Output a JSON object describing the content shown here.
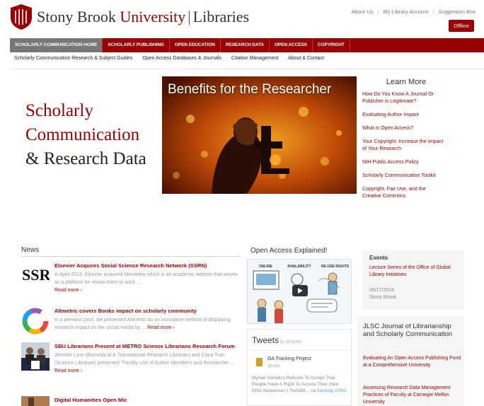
{
  "header": {
    "brand_part1": "Stony Brook ",
    "brand_part2": "University",
    "brand_sep": "|",
    "brand_part3": "Libraries",
    "top_links": [
      "About Us",
      "My Library Account",
      "Suggestion Box"
    ],
    "offline_label": "Offline",
    "accent_color": "#990000"
  },
  "main_nav": [
    "SCHOLARLY COMMUNICATION HOME",
    "SCHOLARLY PUBLISHING",
    "OPEN EDUCATION",
    "RESEARCH DATA",
    "OPEN ACCESS",
    "COPYRIGHT"
  ],
  "sub_nav": [
    "Scholarly Communication Research & Subject Guides",
    "Open Access Databases & Journals",
    "Citation Management",
    "About & Contact"
  ],
  "hero": {
    "title_line1": "Scholarly",
    "title_line2": "Communication",
    "title_line3": "& Research Data",
    "image_caption": "Benefits for the Researcher"
  },
  "learn_more": {
    "title": "Learn More",
    "items": [
      "How Do You Know A Journal Or Publisher is Legitimate?",
      "Evaluating Author Impact",
      "What is Open Access?",
      "Your Copyright: Increase the Impact of Your Research",
      "NIH Public Access Policy",
      "Scholarly Communication Toolkit",
      "Copyright, Fair Use, and the Creative Commons"
    ]
  },
  "news": {
    "title": "News",
    "items": [
      {
        "headline": "Elsevier Acquires Social Science Research Network (SSRN)",
        "text": "In April 2013, Elsevier acquired Mendeley which is an academic website that serves as a platform for researchers to work ...",
        "more": "Read more ›",
        "thumb_label": "SSRN"
      },
      {
        "headline": "Altmetric covers Books impact on scholarly community",
        "text": "In a previous post, we presented Altmetric as an innovative method of displaying research impact on the social media by ...",
        "more": "Read more ›"
      },
      {
        "headline": "SBU Librarians Present at METRO Science Librarians Research Forum",
        "text": "Jennifer Lyon (Biomedical & Translational Research Librarian) and Clara Tran (Science Librarian) presented \"Facility Use of Author Identifiers and Researcher ...",
        "more": "Read more ›"
      },
      {
        "headline": "Digital Humanities Open Mic"
      }
    ]
  },
  "open_access": {
    "title": "Open Access Explained!",
    "video_words": [
      "ONLINE",
      "AVAILABILITY",
      "RE-USE RIGHTS"
    ]
  },
  "tweets": {
    "title": "Tweets",
    "by": "by @sbulib",
    "name": "OA Tracking Project",
    "handle": "@oatp",
    "text": "Myriad Genetics Refuses To Accept That People Have A Right To Access Their Own DNA Sequences | Techdirt... ",
    "link": "oa.tracking.#DNA"
  },
  "events": {
    "title": "Events",
    "text": "Lecture Series of the Office of Global Library Initiatives",
    "date": "06/17/2016",
    "location": "Stony Brook"
  },
  "jlsc": {
    "title": "JLSC Journal of Librarianship and Scholarly Communication",
    "items": [
      "Evaluating An Open Access Publishing Fund at a Comprehensive University",
      "Assessing Research Data Management Practices of Faculty at Carnegie Mellon University"
    ]
  }
}
